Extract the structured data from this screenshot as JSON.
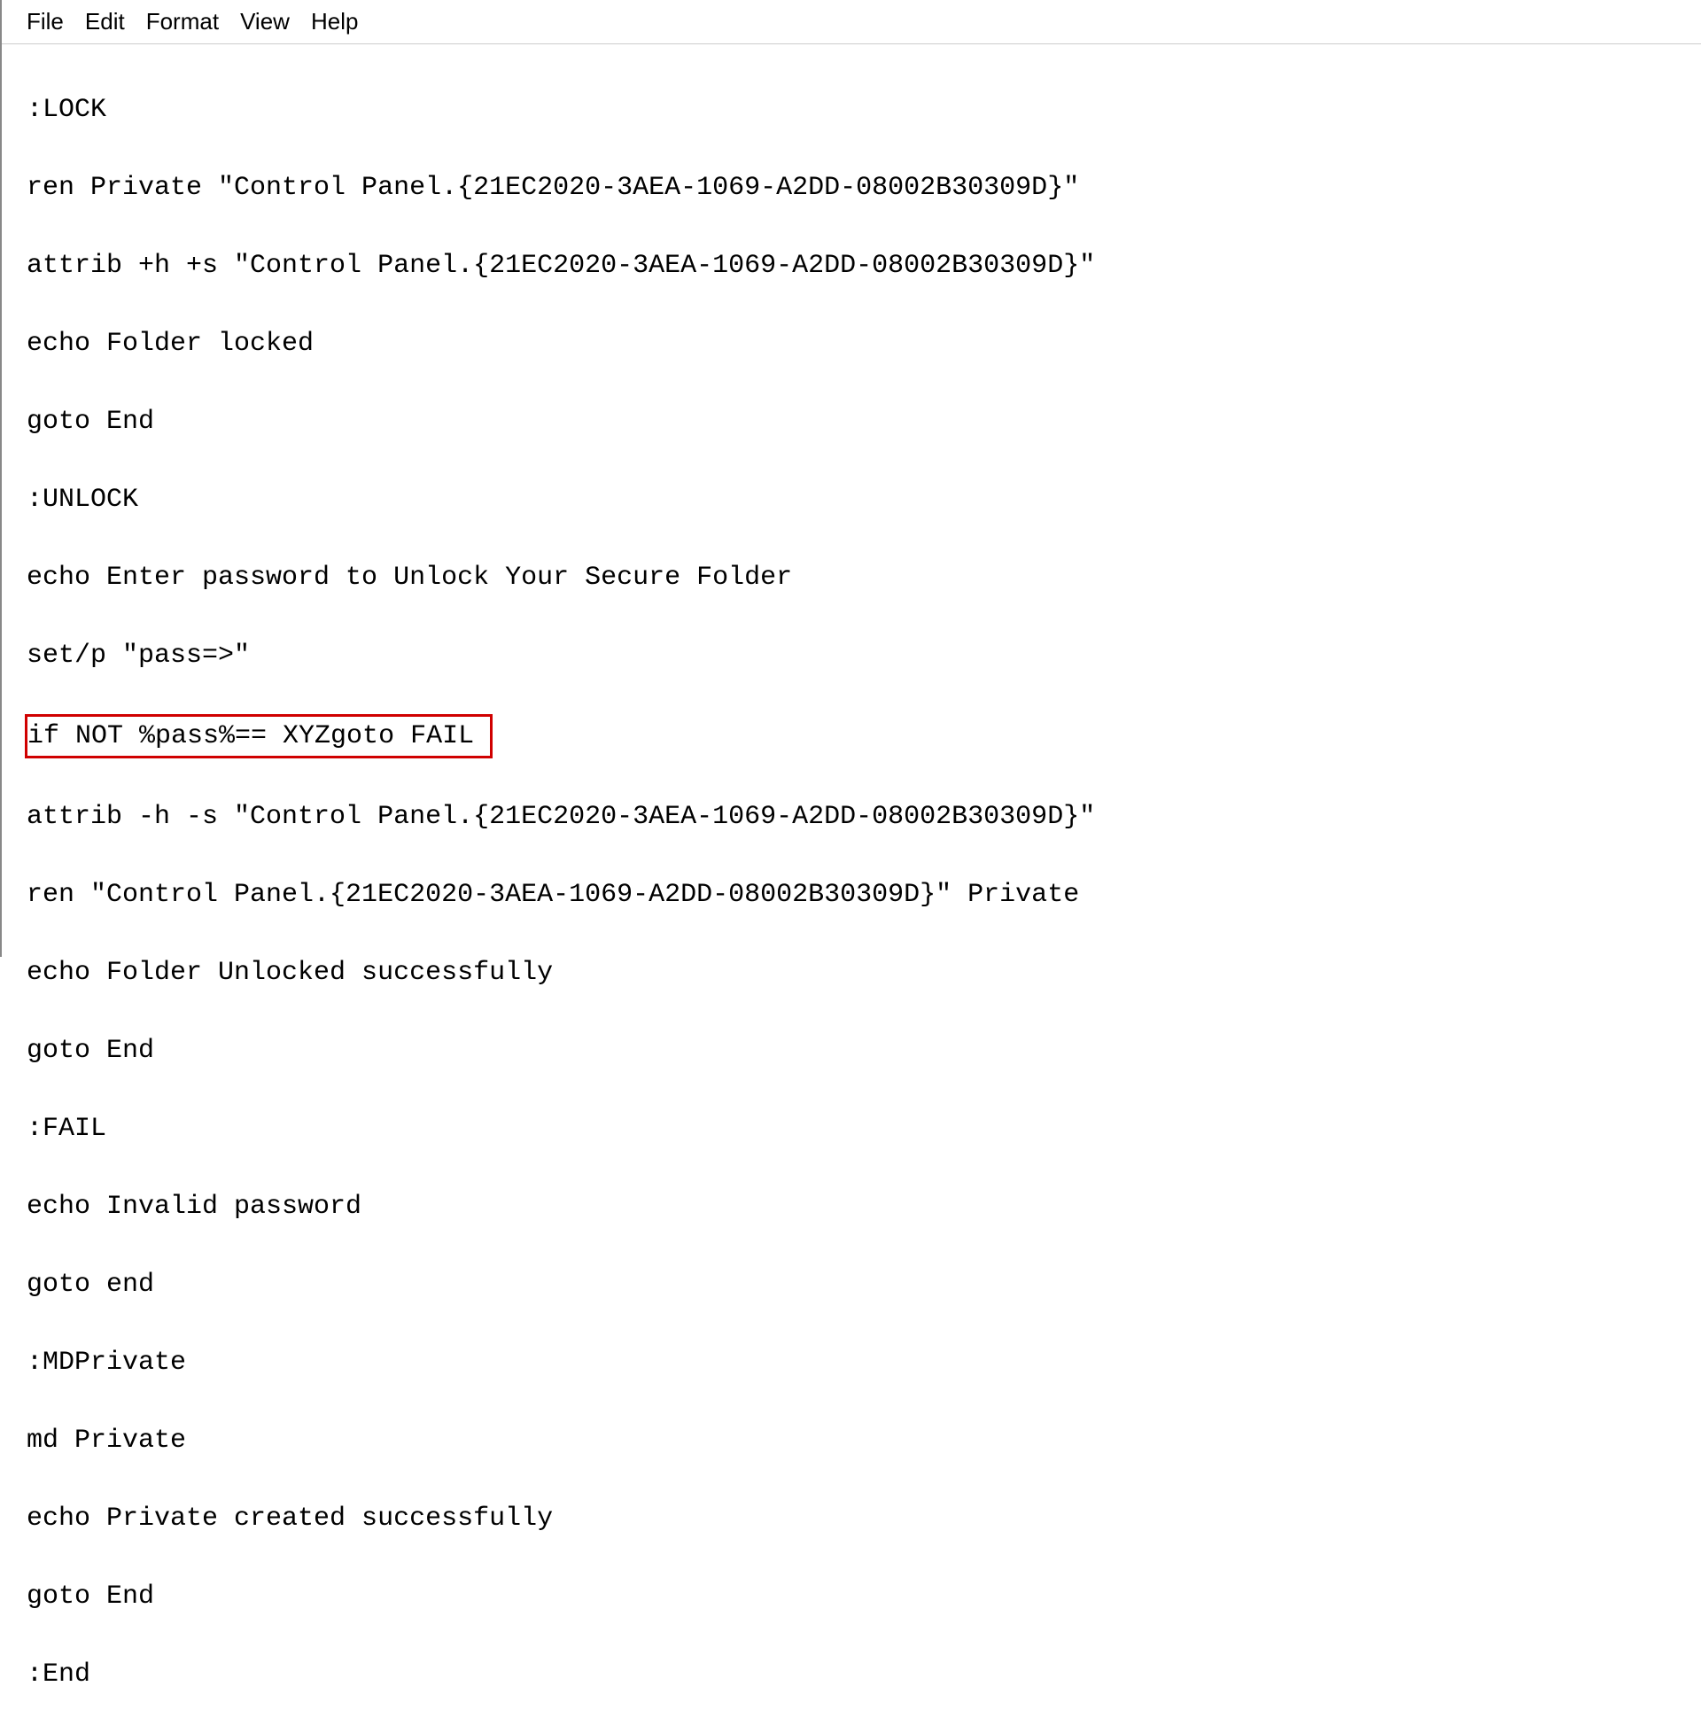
{
  "menubar": {
    "file": "File",
    "edit": "Edit",
    "format": "Format",
    "view": "View",
    "help": "Help"
  },
  "lines": {
    "l0": ":LOCK",
    "l1": "ren Private \"Control Panel.{21EC2020-3AEA-1069-A2DD-08002B30309D}\"",
    "l2": "attrib +h +s \"Control Panel.{21EC2020-3AEA-1069-A2DD-08002B30309D}\"",
    "l3": "echo Folder locked",
    "l4": "goto End",
    "l5": ":UNLOCK",
    "l6": "echo Enter password to Unlock Your Secure Folder",
    "l7": "set/p \"pass=>\"",
    "l8": "if NOT %pass%== XYZgoto FAIL",
    "l9": "attrib -h -s \"Control Panel.{21EC2020-3AEA-1069-A2DD-08002B30309D}\"",
    "l10": "ren \"Control Panel.{21EC2020-3AEA-1069-A2DD-08002B30309D}\" Private",
    "l11": "echo Folder Unlocked successfully",
    "l12": "goto End",
    "l13": ":FAIL",
    "l14": "echo Invalid password",
    "l15": "goto end",
    "l16": ":MDPrivate",
    "l17": "md Private",
    "l18": "echo Private created successfully",
    "l19": "goto End",
    "l20": ":End"
  }
}
